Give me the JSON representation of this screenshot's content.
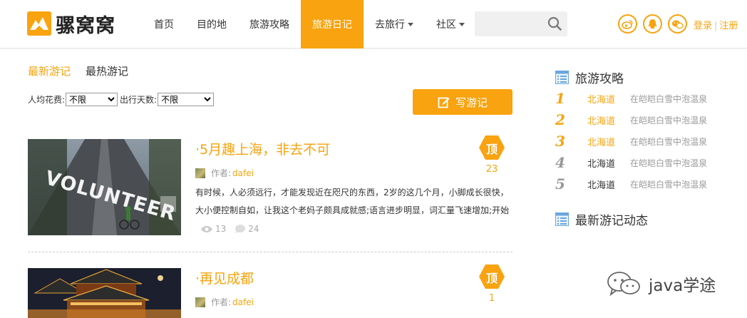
{
  "brand": {
    "name": "骡窝窝"
  },
  "nav": {
    "items": [
      {
        "label": "首页"
      },
      {
        "label": "目的地"
      },
      {
        "label": "旅游攻略"
      },
      {
        "label": "旅游日记"
      },
      {
        "label": "去旅行"
      },
      {
        "label": "社区"
      }
    ]
  },
  "auth": {
    "login": "登录",
    "separator": "|",
    "register": "注册"
  },
  "tabs": [
    {
      "label": "最新游记"
    },
    {
      "label": "最热游记"
    }
  ],
  "filters": {
    "cost_label": "人均花费:",
    "cost_value": "不限",
    "days_label": "出行天数:",
    "days_value": "不限"
  },
  "write_button": "写游记",
  "entries": [
    {
      "title": "·5月趣上海，非去不可",
      "author_label": "作者:",
      "author": "dafei",
      "text_line1": "有时候，人必须远行，才能发现近在咫尺的东西，2岁的这几个月，小脚成长很快，",
      "text_line2": "大小便控制自如，让我这个老妈子颇具成就感;语言进步明显，词汇量飞速增加;开始",
      "views": "13",
      "comments": "24",
      "top_label": "顶",
      "top_count": "23"
    },
    {
      "title": "·再见成都",
      "author_label": "作者:",
      "author": "dafei",
      "top_label": "顶",
      "top_count": "1"
    }
  ],
  "sidebar": {
    "guides_title": "旅游攻略",
    "guides": [
      {
        "rank": "1",
        "place": "北海道",
        "desc": "在皑皑白雪中泡温泉",
        "highlight": true
      },
      {
        "rank": "2",
        "place": "北海道",
        "desc": "在皑皑白雪中泡温泉",
        "highlight": true
      },
      {
        "rank": "3",
        "place": "北海道",
        "desc": "在皑皑白雪中泡温泉",
        "highlight": true
      },
      {
        "rank": "4",
        "place": "北海道",
        "desc": "在皑皑白雪中泡温泉",
        "highlight": false
      },
      {
        "rank": "5",
        "place": "北海道",
        "desc": "在皑皑白雪中泡温泉",
        "highlight": false
      }
    ],
    "latest_title": "最新游记动态"
  },
  "watermark": "java学途",
  "colors": {
    "accent": "#f8a30f",
    "rank_muted": "#999999",
    "text": "#333333"
  }
}
